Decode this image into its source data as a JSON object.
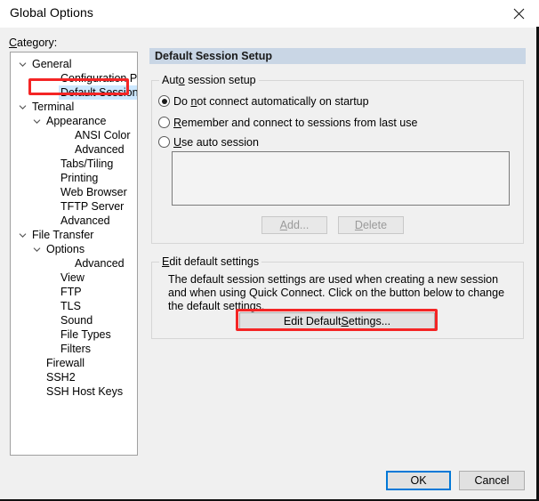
{
  "window": {
    "title": "Global Options",
    "close_icon": "close-icon"
  },
  "category": {
    "label_pre": "C",
    "label_post": "ategory:"
  },
  "tree": {
    "items": [
      {
        "label": "General",
        "indent": 0,
        "expander": "chevron-down",
        "selected": false
      },
      {
        "label": "Configuration Paths",
        "indent": 2,
        "expander": "none",
        "selected": false
      },
      {
        "label": "Default Session",
        "indent": 2,
        "expander": "none",
        "selected": true
      },
      {
        "label": "Terminal",
        "indent": 0,
        "expander": "chevron-down",
        "selected": false
      },
      {
        "label": "Appearance",
        "indent": 1,
        "expander": "chevron-down",
        "selected": false
      },
      {
        "label": "ANSI Color",
        "indent": 3,
        "expander": "none",
        "selected": false
      },
      {
        "label": "Advanced",
        "indent": 3,
        "expander": "none",
        "selected": false
      },
      {
        "label": "Tabs/Tiling",
        "indent": 2,
        "expander": "none",
        "selected": false
      },
      {
        "label": "Printing",
        "indent": 2,
        "expander": "none",
        "selected": false
      },
      {
        "label": "Web Browser",
        "indent": 2,
        "expander": "none",
        "selected": false
      },
      {
        "label": "TFTP Server",
        "indent": 2,
        "expander": "none",
        "selected": false
      },
      {
        "label": "Advanced",
        "indent": 2,
        "expander": "none",
        "selected": false
      },
      {
        "label": "File Transfer",
        "indent": 0,
        "expander": "chevron-down",
        "selected": false
      },
      {
        "label": "Options",
        "indent": 1,
        "expander": "chevron-down",
        "selected": false
      },
      {
        "label": "Advanced",
        "indent": 3,
        "expander": "none",
        "selected": false
      },
      {
        "label": "View",
        "indent": 2,
        "expander": "none",
        "selected": false
      },
      {
        "label": "FTP",
        "indent": 2,
        "expander": "none",
        "selected": false
      },
      {
        "label": "TLS",
        "indent": 2,
        "expander": "none",
        "selected": false
      },
      {
        "label": "Sound",
        "indent": 2,
        "expander": "none",
        "selected": false
      },
      {
        "label": "File Types",
        "indent": 2,
        "expander": "none",
        "selected": false
      },
      {
        "label": "Filters",
        "indent": 2,
        "expander": "none",
        "selected": false
      },
      {
        "label": "Firewall",
        "indent": 1,
        "expander": "none",
        "selected": false
      },
      {
        "label": "SSH2",
        "indent": 1,
        "expander": "none",
        "selected": false
      },
      {
        "label": "SSH Host Keys",
        "indent": 1,
        "expander": "none",
        "selected": false
      }
    ]
  },
  "panel": {
    "header": "Default Session Setup"
  },
  "auto_session": {
    "group_title_parts": [
      "Aut",
      "o",
      " session setup"
    ],
    "options": [
      {
        "pre": "Do ",
        "mn": "n",
        "post": "ot connect automatically on startup",
        "checked": true
      },
      {
        "pre": "",
        "mn": "R",
        "post": "emember and connect to sessions from last use",
        "checked": false
      },
      {
        "pre": "",
        "mn": "U",
        "post": "se auto session",
        "checked": false
      }
    ],
    "listbox_items": [],
    "add_button": {
      "mn": "A",
      "pre": "",
      "post": "dd...",
      "enabled": false
    },
    "delete_button": {
      "mn": "D",
      "pre": "",
      "post": "elete",
      "enabled": false
    }
  },
  "edit_default": {
    "group_title_parts": [
      "E",
      "dit default settings"
    ],
    "description": "The default session settings are used when creating a new session and when using Quick Connect.  Click on the button below to change the default settings.",
    "button": {
      "pre": "Edit Default ",
      "mn": "S",
      "post": "ettings..."
    }
  },
  "footer": {
    "ok_label": "OK",
    "cancel_label": "Cancel"
  },
  "annotations": {
    "color": "#f42525",
    "targets": [
      "Default Session",
      "Edit Default Settings..."
    ]
  }
}
